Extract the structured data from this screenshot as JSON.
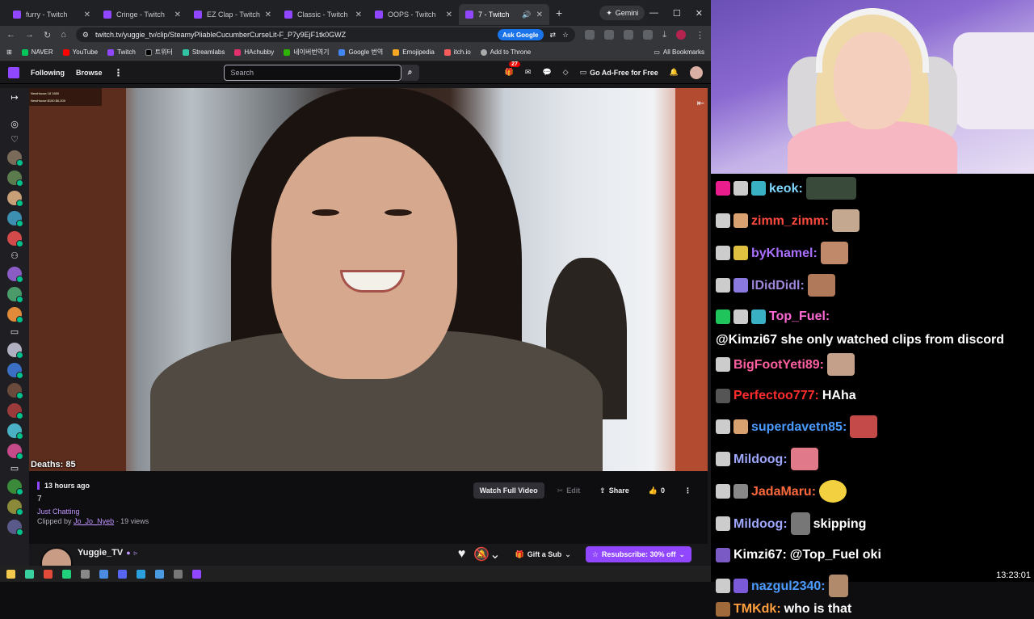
{
  "browser": {
    "tabs": [
      {
        "title": "furry - Twitch",
        "active": false
      },
      {
        "title": "Cringe - Twitch",
        "active": false
      },
      {
        "title": "EZ Clap - Twitch",
        "active": false
      },
      {
        "title": "Classic - Twitch",
        "active": false
      },
      {
        "title": "OOPS - Twitch",
        "active": false
      },
      {
        "title": "7 - Twitch",
        "active": true
      }
    ],
    "new_tab": "+",
    "gemini_label": "Gemini",
    "url": "twitch.tv/yuggie_tv/clip/SteamyPliableCucumberCurseLit-F_P7y9EjF1tk0GWZ",
    "ask_google": "Ask Google",
    "bookmarks": [
      "NAVER",
      "YouTube",
      "Twitch",
      "트위터",
      "Streamlabs",
      "HAchubby",
      "네이버번역기",
      "Google 번역",
      "Emojipedia",
      "itch.io",
      "Add to Throne"
    ],
    "all_bookmarks": "All Bookmarks"
  },
  "twitch_nav": {
    "following": "Following",
    "browse": "Browse",
    "search_placeholder": "Search",
    "notification_count": "27",
    "ad_free": "Go Ad-Free for Free"
  },
  "video": {
    "stats_line1": "NewHouse 18 1650",
    "stats_line2": "NewHouse $150 $6,200",
    "deaths": "Deaths: 85"
  },
  "clip": {
    "time_ago": "13 hours ago",
    "title": "7",
    "category": "Just Chatting",
    "clipped_by_prefix": "Clipped by",
    "clipper": "Jo_Jo_Nyeb",
    "views": "· 19 views",
    "watch_full": "Watch Full Video",
    "edit": "Edit",
    "share": "Share",
    "likes": "0"
  },
  "channel": {
    "name": "Yuggie_TV",
    "gift_sub": "Gift a Sub",
    "resubscribe": "Resubscribe: 30% off"
  },
  "chat": {
    "messages": [
      {
        "user": "keok:",
        "color": "#7fd6ff",
        "text": ""
      },
      {
        "user": "zimm_zimm:",
        "color": "#ff4a3d",
        "text": ""
      },
      {
        "user": "byKhamel:",
        "color": "#a970ff",
        "text": ""
      },
      {
        "user": "lDidDidl:",
        "color": "#9e86d9",
        "text": ""
      },
      {
        "user": "Top_Fuel:",
        "color": "#ff6ad5",
        "text": "@Kimzi67 she only watched clips from discord"
      },
      {
        "user": "BigFootYeti89:",
        "color": "#ff5fa0",
        "text": ""
      },
      {
        "user": "Perfectoo777:",
        "color": "#ff2d2d",
        "text": "HAha"
      },
      {
        "user": "superdavetn85:",
        "color": "#4b9bff",
        "text": ""
      },
      {
        "user": "Mildoog:",
        "color": "#9fa8ff",
        "text": ""
      },
      {
        "user": "JadaMaru:",
        "color": "#ff6a3d",
        "text": ""
      },
      {
        "user": "Mildoog:",
        "color": "#9fa8ff",
        "text": "skipping"
      },
      {
        "user": "Kimzi67:",
        "color": "#ffffff",
        "text": "@Top_Fuel oki"
      },
      {
        "user": "nazgul2340:",
        "color": "#4b9bff",
        "text": ""
      },
      {
        "user": "TMKdk:",
        "color": "#ff9f3d",
        "text": "who is that"
      }
    ]
  },
  "clock": "13:23:01"
}
